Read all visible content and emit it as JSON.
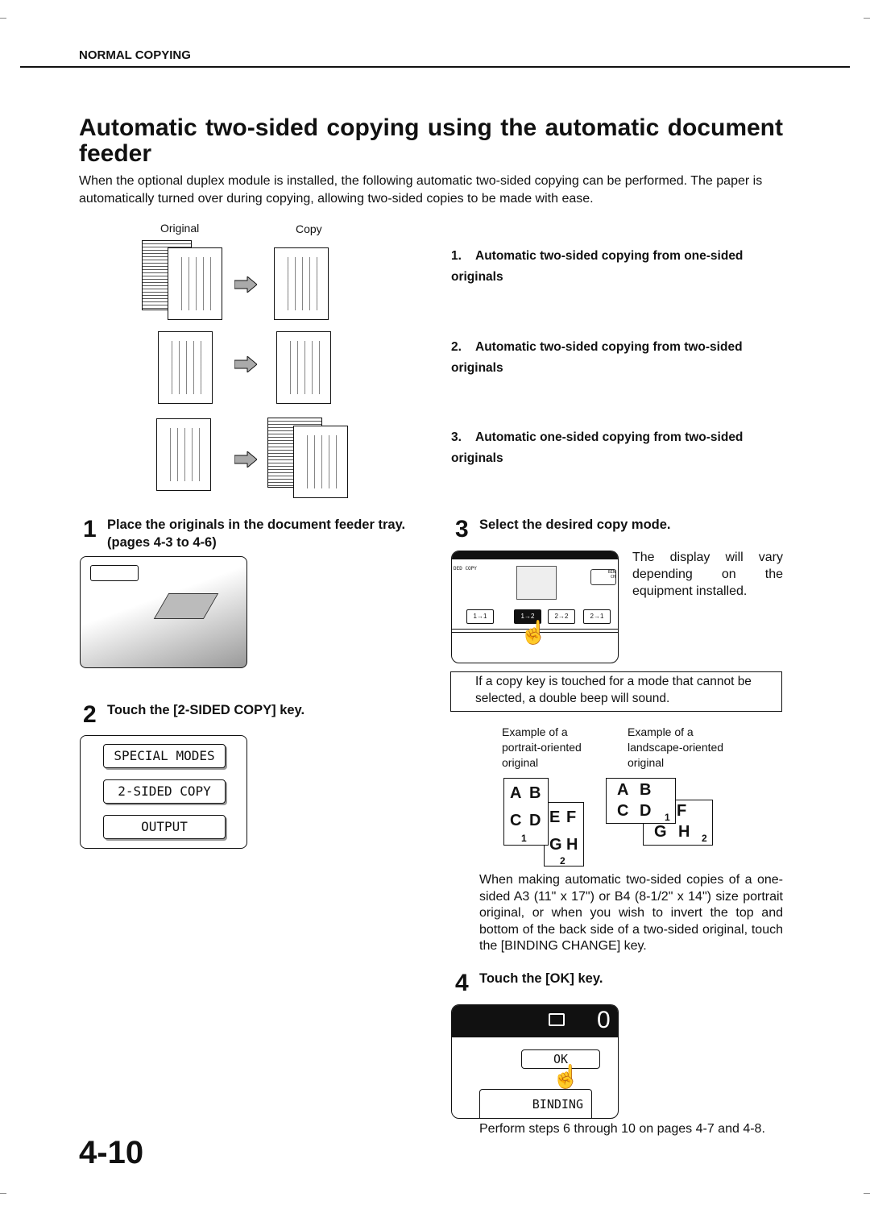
{
  "header": {
    "section": "NORMAL COPYING"
  },
  "title": "Automatic two-sided copying using the automatic document feeder",
  "intro": "When the optional duplex module is installed, the following automatic two-sided copying can be performed. The paper is automatically turned over during copying, allowing two-sided copies to be made with ease.",
  "diagram": {
    "original_label": "Original",
    "copy_label": "Copy"
  },
  "modes": [
    {
      "num": "1.",
      "text": "Automatic two-sided copying from one-sided originals"
    },
    {
      "num": "2.",
      "text": "Automatic two-sided copying from two-sided originals"
    },
    {
      "num": "3.",
      "text": "Automatic one-sided copying from two-sided originals"
    }
  ],
  "steps": {
    "s1": {
      "num": "1",
      "title": "Place the originals in the document feeder tray. (pages 4-3 to 4-6)"
    },
    "s2": {
      "num": "2",
      "title": "Touch the [2-SIDED COPY] key.",
      "keys": [
        "SPECIAL MODES",
        "2-SIDED COPY",
        "OUTPUT"
      ]
    },
    "s3": {
      "num": "3",
      "title": "Select the desired copy mode.",
      "desc": "The display will vary depending on the equipment installed.",
      "screen_title": "DED COPY",
      "binding_text": [
        "BIN",
        "CH"
      ],
      "mode_keys": [
        "1→1",
        "1→2",
        "2→2",
        "2→1"
      ],
      "note": "If a copy key is touched for a mode that cannot be selected, a double beep will sound.",
      "examples": {
        "portrait": "Example of a portrait-oriented original",
        "landscape": "Example of a landscape-oriented original",
        "letters": [
          "A",
          "B",
          "C",
          "D",
          "E",
          "F",
          "G",
          "H"
        ],
        "side1": "1",
        "side2": "2"
      },
      "binding_desc": "When making automatic two-sided copies of a one-sided A3 (11\" x 17\") or B4 (8-1/2\" x 14\") size portrait original, or when you wish to invert the top and bottom of the back side of a two-sided original, touch the [BINDING CHANGE] key."
    },
    "s4": {
      "num": "4",
      "title": "Touch the [OK] key.",
      "count": "0",
      "ok_label": "OK",
      "binding_label": "BINDING",
      "footer": "Perform steps 6 through 10 on pages 4-7 and 4-8."
    }
  },
  "page_number": "4-10"
}
